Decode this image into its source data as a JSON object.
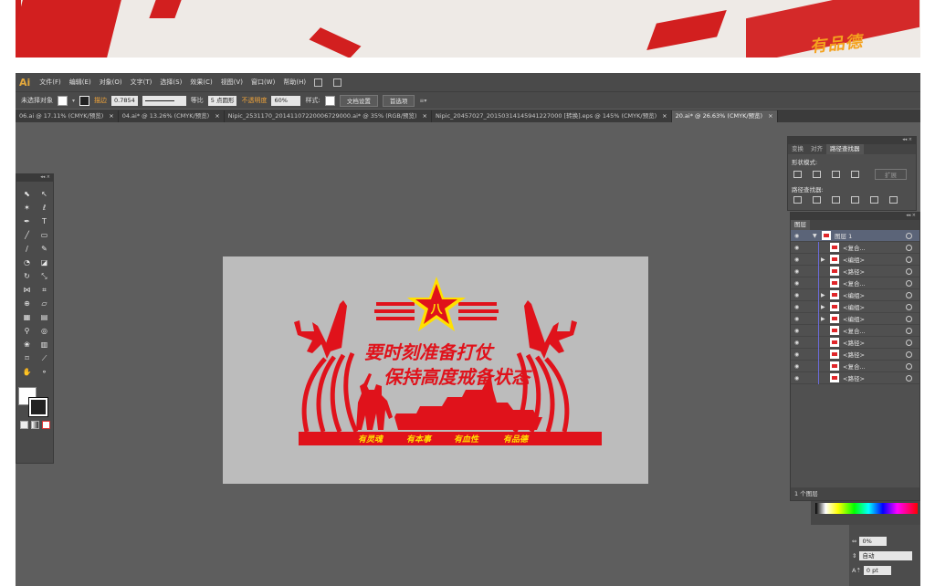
{
  "banner": {
    "text": "有品德"
  },
  "app": {
    "logo": "Ai",
    "menu": [
      "文件(F)",
      "编辑(E)",
      "对象(O)",
      "文字(T)",
      "选择(S)",
      "效果(C)",
      "视图(V)",
      "窗口(W)",
      "帮助(H)"
    ],
    "control": {
      "selection": "未选择对象",
      "stroke_label": "描边",
      "stroke_value": "0.7854",
      "profile": "等比",
      "brush": "5 点圆形",
      "opacity_label": "不透明度",
      "opacity_value": "60%",
      "style_label": "样式:",
      "doc_setup": "文档设置",
      "preferences": "首选项"
    },
    "tabs": [
      {
        "label": "06.ai @ 17.11% (CMYK/预览)",
        "close": "×"
      },
      {
        "label": "04.ai* @ 13.26% (CMYK/预览)",
        "close": "×"
      },
      {
        "label": "Nipic_2531170_20141107220006729000.ai* @ 35% (RGB/预览)",
        "close": "×"
      },
      {
        "label": "Nipic_20457027_20150314145941227000 [转换].eps @ 145% (CMYK/预览)",
        "close": "×"
      },
      {
        "label": "20.ai* @ 26.63% (CMYK/预览)",
        "close": "×"
      }
    ],
    "active_tab": 4
  },
  "artwork": {
    "line1": "要时刻准备打仗",
    "line2": "保持高度戒备状态",
    "slogans": [
      "有灵魂",
      "有本事",
      "有血性",
      "有品德"
    ],
    "colors": {
      "red": "#e0121b",
      "gold": "#ffe000",
      "backdrop": "#bcbcbc"
    }
  },
  "pathfinder": {
    "tabs": [
      "变换",
      "对齐",
      "路径查找器"
    ],
    "active_tab": 2,
    "shape_modes_label": "形状模式:",
    "pathfinders_label": "路径查找器:",
    "expand_label": "扩展"
  },
  "layers": {
    "tab": "图层",
    "top_layer": "图层 1",
    "items": [
      {
        "name": "<复合...",
        "arrow": ""
      },
      {
        "name": "<编组>",
        "arrow": "▶"
      },
      {
        "name": "<路径>",
        "arrow": ""
      },
      {
        "name": "<复合...",
        "arrow": ""
      },
      {
        "name": "<编组>",
        "arrow": "▶"
      },
      {
        "name": "<编组>",
        "arrow": "▶"
      },
      {
        "name": "<编组>",
        "arrow": "▶"
      },
      {
        "name": "<复合...",
        "arrow": ""
      },
      {
        "name": "<路径>",
        "arrow": ""
      },
      {
        "name": "<路径>",
        "arrow": ""
      },
      {
        "name": "<复合...",
        "arrow": ""
      },
      {
        "name": "<路径>",
        "arrow": ""
      }
    ],
    "footer": "1 个图层"
  },
  "character": {
    "tracking_value": "0%",
    "auto_label": "自动",
    "size_value": "0 pt"
  }
}
